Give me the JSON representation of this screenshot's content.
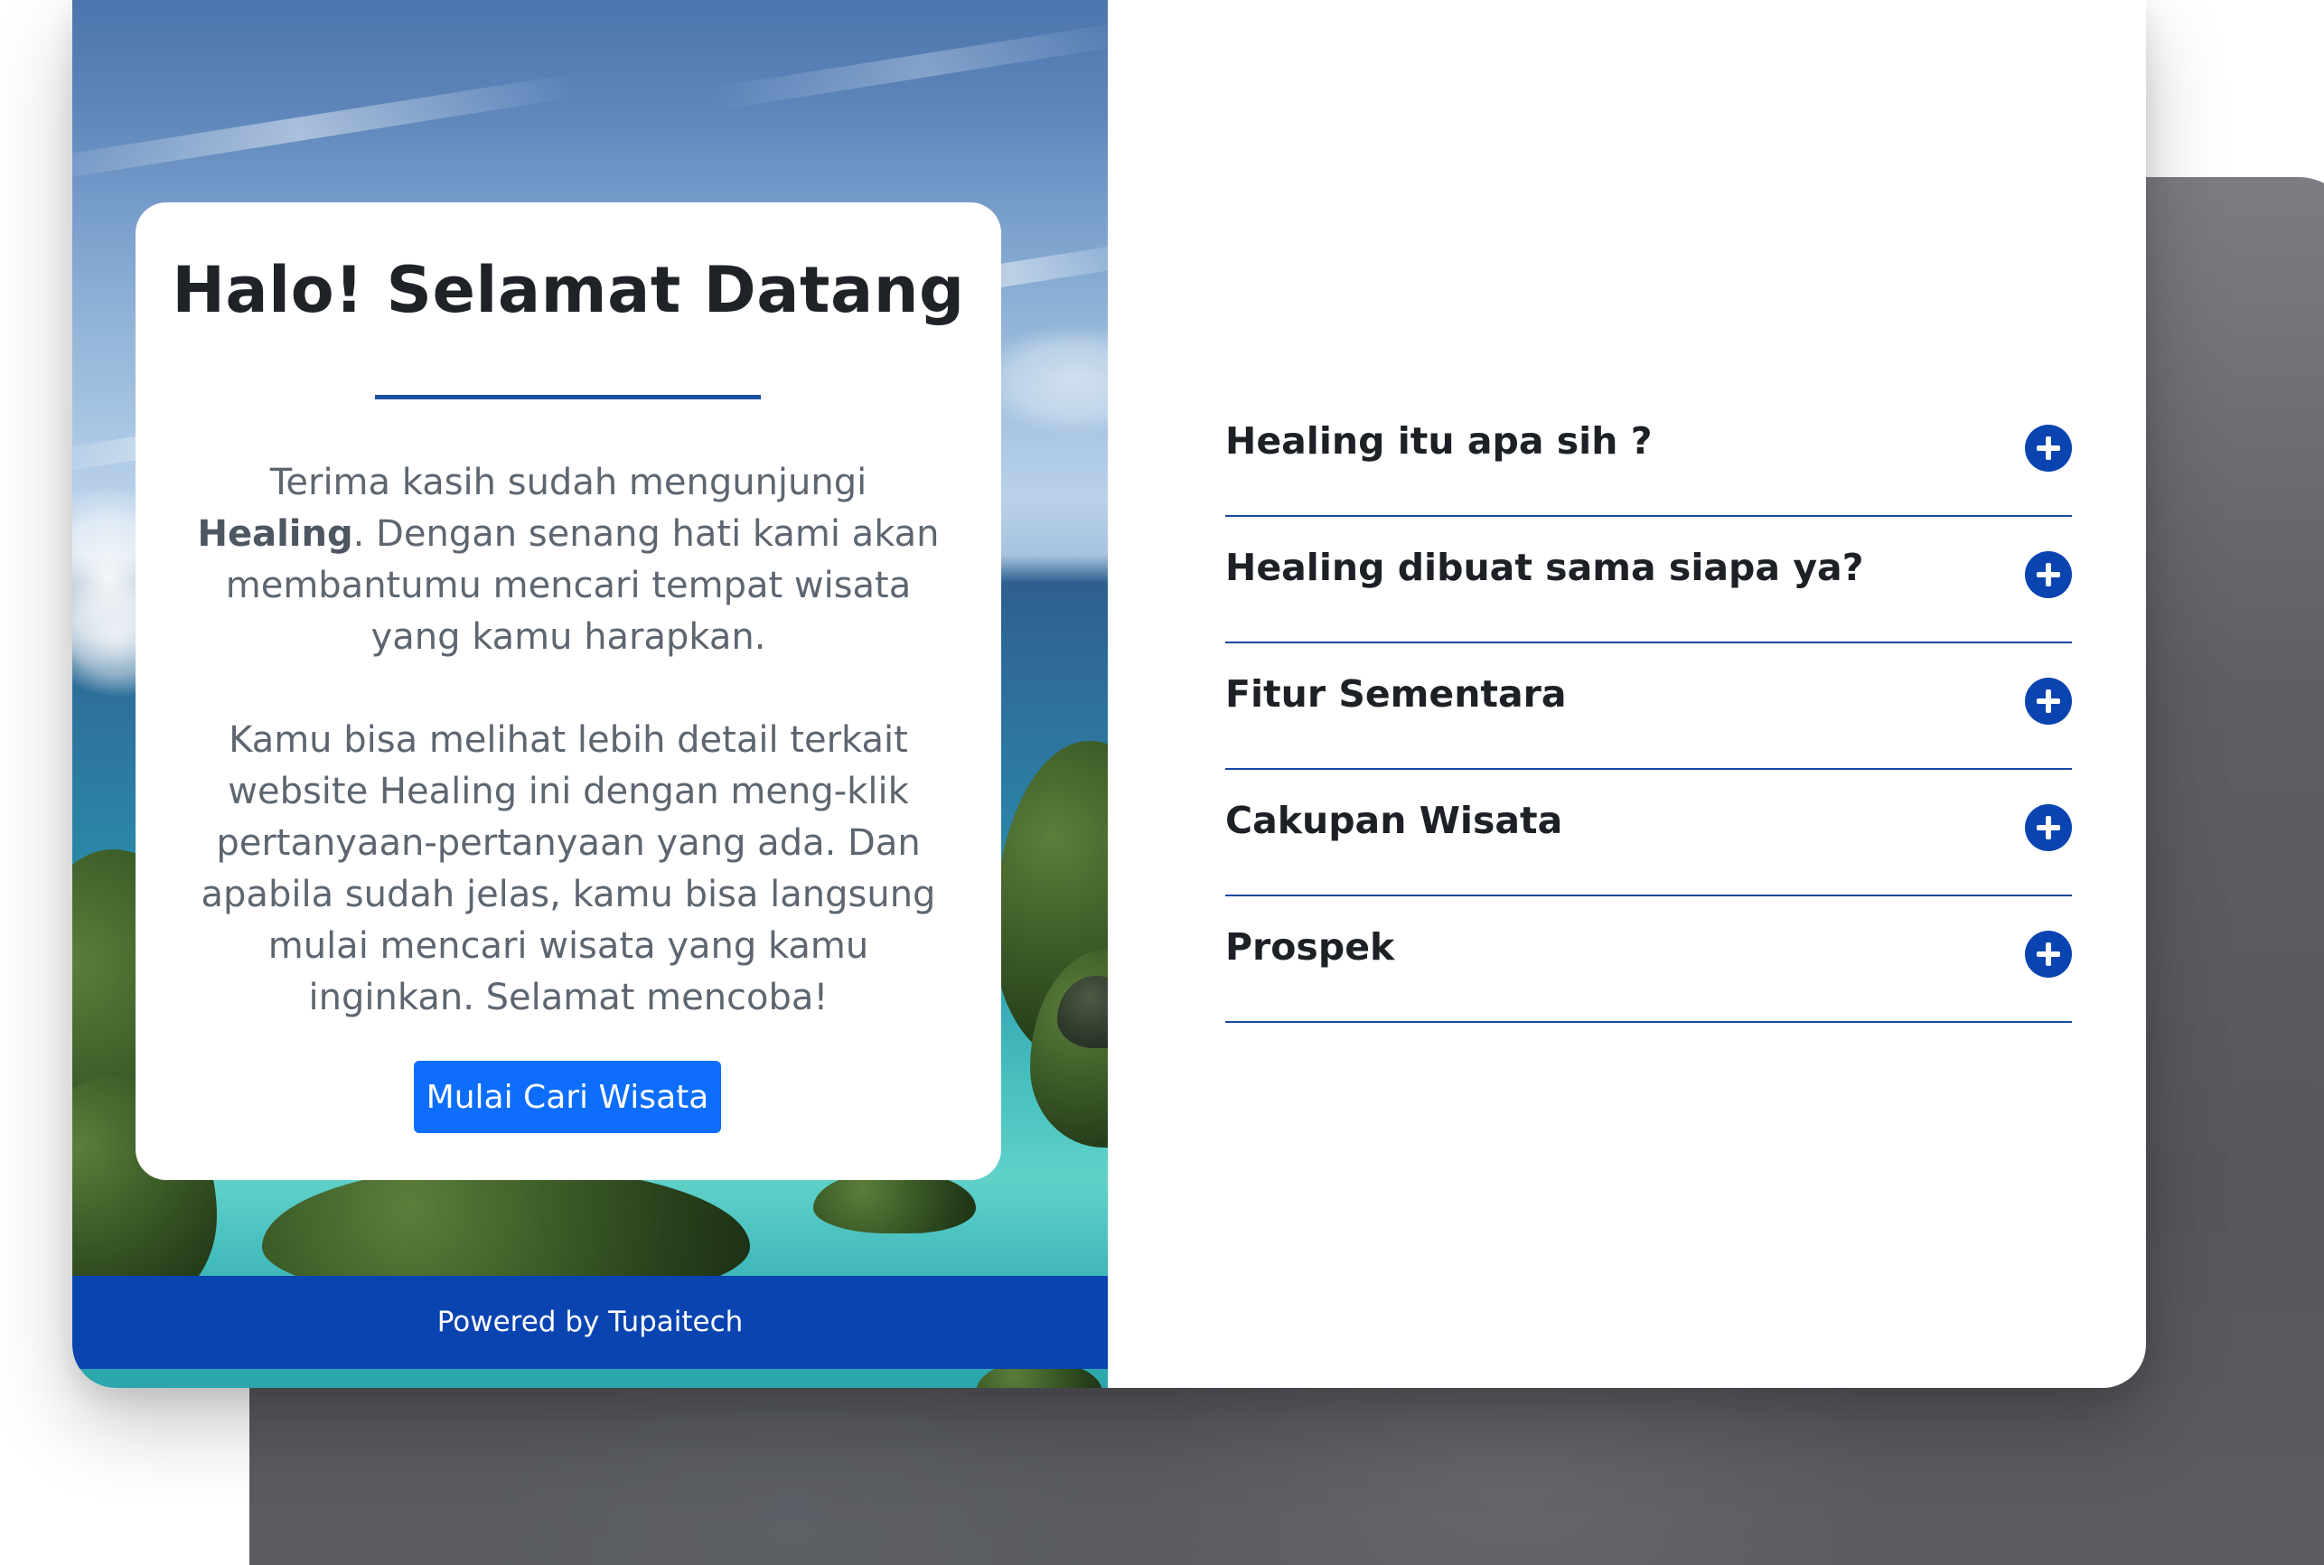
{
  "welcome": {
    "title": "Halo! Selamat Datang",
    "para1_before": "Terima kasih sudah mengunjungi ",
    "para1_bold": "Healing",
    "para1_after": ". Dengan senang hati kami akan membantumu mencari tempat wisata yang kamu harapkan.",
    "para2": "Kamu bisa melihat lebih detail terkait website Healing ini dengan meng-klik pertanyaan-pertanyaan yang ada. Dan apabila sudah jelas, kamu bisa langsung mulai mencari wisata yang kamu inginkan. Selamat mencoba!",
    "cta_label": "Mulai Cari Wisata"
  },
  "footer": {
    "text": "Powered by Tupaitech"
  },
  "faq": {
    "items": [
      {
        "question": "Healing itu apa sih ?",
        "icon": "plus-circle-icon"
      },
      {
        "question": "Healing dibuat sama siapa ya?",
        "icon": "plus-circle-icon"
      },
      {
        "question": "Fitur Sementara",
        "icon": "plus-circle-icon"
      },
      {
        "question": "Cakupan Wisata",
        "icon": "plus-circle-icon"
      },
      {
        "question": "Prospek",
        "icon": "plus-circle-icon"
      }
    ]
  },
  "colors": {
    "brand_blue": "#0a44b1",
    "button_blue": "#0d6efd",
    "heading_text": "#1f2328",
    "body_text": "#5d6670"
  }
}
